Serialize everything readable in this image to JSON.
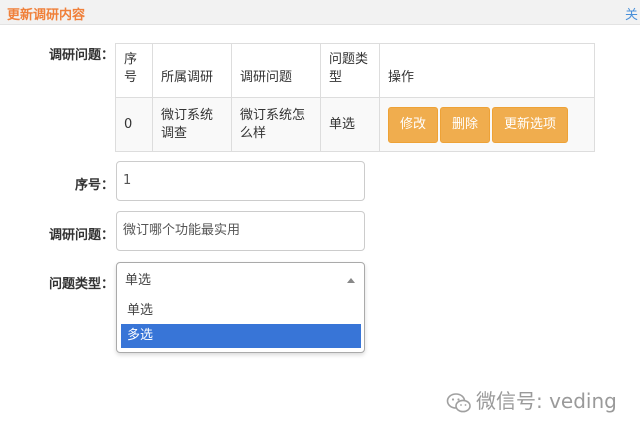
{
  "window": {
    "title": "更新调研内容",
    "close_glyph": "关"
  },
  "form": {
    "survey_question_label": "调研问题：",
    "serial_label": "序号：",
    "question_label": "调研问题：",
    "type_label": "问题类型：",
    "serial_value": "1",
    "question_value": "微订哪个功能最实用"
  },
  "table": {
    "headers": [
      "序号",
      "所属调研",
      "调研问题",
      "问题类型",
      "操作"
    ],
    "rows": [
      {
        "serial": "0",
        "survey": "微订系统调查",
        "question": "微订系统怎么样",
        "type": "单选"
      }
    ],
    "actions": {
      "edit": "修改",
      "delete": "删除",
      "update_options": "更新选项"
    }
  },
  "select": {
    "current": "单选",
    "options": [
      "单选",
      "多选"
    ],
    "highlighted": "多选"
  },
  "watermark": {
    "text": "微信号: veding",
    "icon": "wechat-icon"
  }
}
